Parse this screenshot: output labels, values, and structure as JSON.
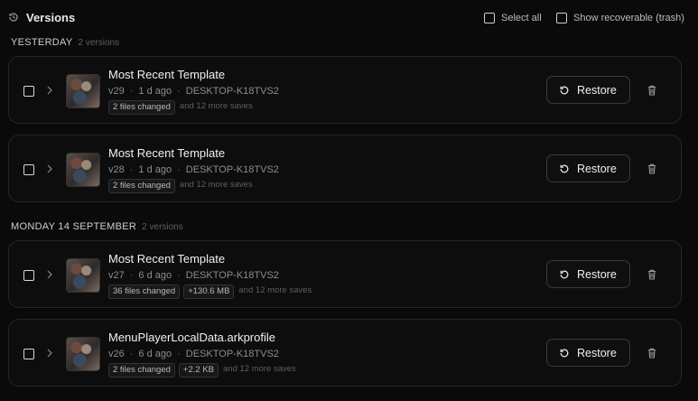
{
  "header": {
    "title": "Versions",
    "select_all_label": "Select all",
    "show_recoverable_label": "Show recoverable (trash)"
  },
  "groups": [
    {
      "label": "YESTERDAY",
      "count": "2 versions",
      "items": [
        {
          "name": "Most Recent Template",
          "version": "v29",
          "age": "1 d ago",
          "host": "DESKTOP-K18TVS2",
          "badges": [
            "2 files changed"
          ],
          "more": "and 12 more saves"
        },
        {
          "name": "Most Recent Template",
          "version": "v28",
          "age": "1 d ago",
          "host": "DESKTOP-K18TVS2",
          "badges": [
            "2 files changed"
          ],
          "more": "and 12 more saves"
        }
      ]
    },
    {
      "label": "MONDAY 14 SEPTEMBER",
      "count": "2 versions",
      "items": [
        {
          "name": "Most Recent Template",
          "version": "v27",
          "age": "6 d ago",
          "host": "DESKTOP-K18TVS2",
          "badges": [
            "36 files changed",
            "+130.6 MB"
          ],
          "more": "and 12 more saves"
        },
        {
          "name": "MenuPlayerLocalData.arkprofile",
          "version": "v26",
          "age": "6 d ago",
          "host": "DESKTOP-K18TVS2",
          "badges": [
            "2 files changed",
            "+2.2 KB"
          ],
          "more": "and 12 more saves"
        }
      ]
    }
  ],
  "restore_label": "Restore",
  "meta_separator": "·",
  "icons": {
    "header": "history-icon",
    "restore": "restore-icon",
    "delete": "trash-icon",
    "expand": "chevron-right-icon",
    "thumbnail": "profile-thumbnail"
  }
}
